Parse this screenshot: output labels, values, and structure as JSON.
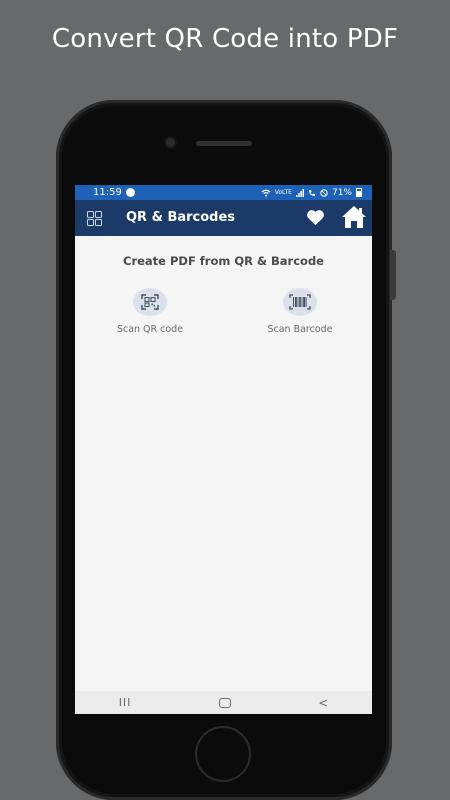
{
  "headline": "Convert QR Code into PDF",
  "status_bar": {
    "time": "11:59",
    "network": "VoLTE",
    "battery": "71%"
  },
  "app_bar": {
    "title": "QR & Barcodes",
    "icons": [
      "grid-menu-icon",
      "heart-icon",
      "home-icon"
    ]
  },
  "main": {
    "section_title": "Create PDF from QR & Barcode",
    "actions": [
      {
        "label": "Scan QR code",
        "icon": "qr-scan-icon"
      },
      {
        "label": "Scan Barcode",
        "icon": "barcode-scan-icon"
      }
    ]
  },
  "nav_bar": {
    "recents_glyph": "III",
    "back_glyph": "<"
  },
  "colors": {
    "background": "#68696b",
    "status_bar": "#1d62b7",
    "app_bar": "#1b3a67",
    "screen_bg": "#f5f5f5"
  }
}
